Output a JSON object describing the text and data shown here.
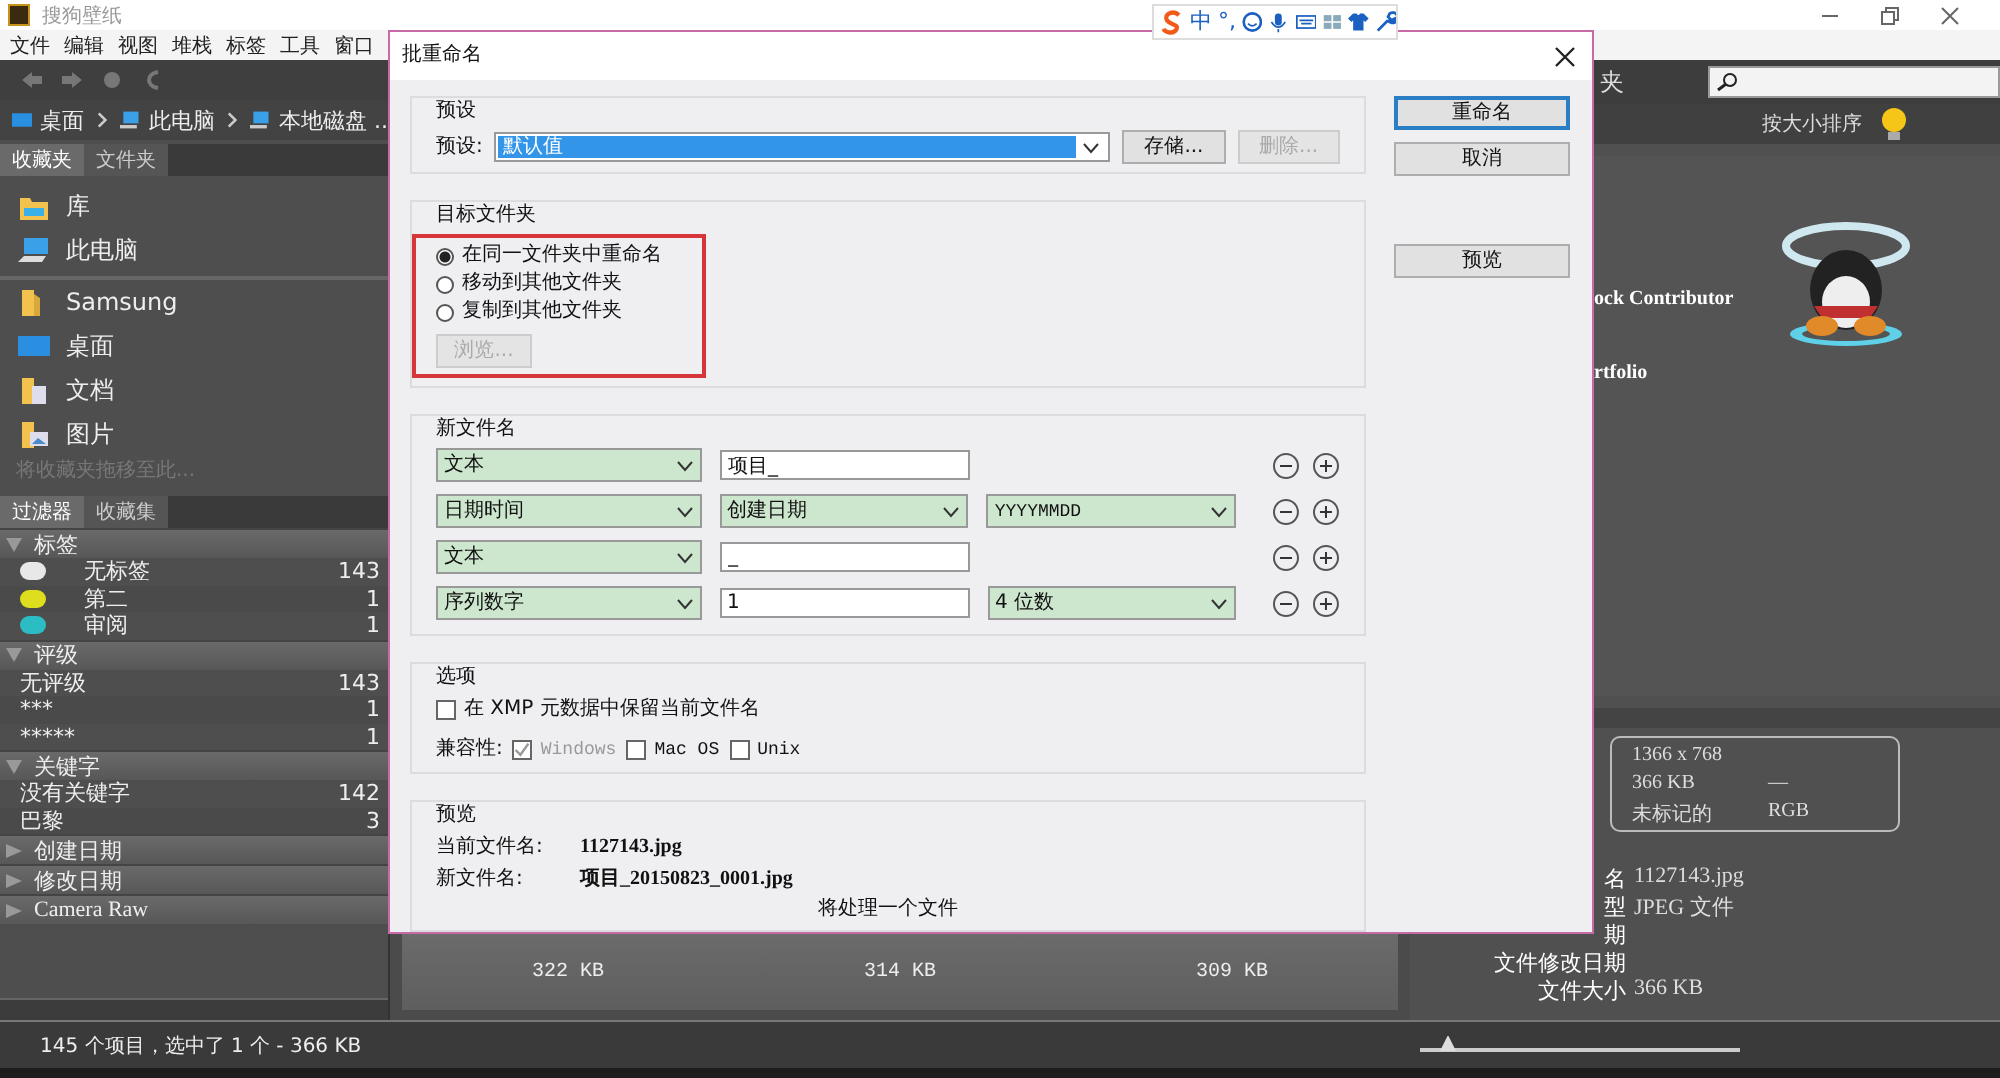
{
  "window": {
    "title": "搜狗壁纸"
  },
  "menu": [
    "文件",
    "编辑",
    "视图",
    "堆栈",
    "标签",
    "工具",
    "窗口"
  ],
  "ime_toolbar": {
    "mode": "中",
    "punct": "°,"
  },
  "left_panel": {
    "path": [
      "桌面",
      "此电脑",
      "本地磁盘 .."
    ],
    "tabs": [
      {
        "label": "收藏夹",
        "selected": true
      },
      {
        "label": "文件夹",
        "selected": false
      }
    ],
    "favorites": [
      {
        "label": "库",
        "kind": "library"
      },
      {
        "label": "此电脑",
        "kind": "computer"
      },
      {
        "label": "Samsung",
        "kind": "folder"
      },
      {
        "label": "桌面",
        "kind": "desktop"
      },
      {
        "label": "文档",
        "kind": "document"
      },
      {
        "label": "图片"
      }
    ],
    "hint": "将收藏夹拖移至此...",
    "filter_tabs": [
      {
        "label": "过滤器",
        "selected": true
      },
      {
        "label": "收藏集",
        "selected": false
      }
    ],
    "filter_groups": [
      {
        "title": "标签",
        "expanded": true,
        "items": [
          {
            "label": "无标签",
            "count": "143",
            "color": "#e8e8e8"
          },
          {
            "label": "第二",
            "count": "1",
            "color": "#dede1e"
          },
          {
            "label": "审阅",
            "count": "1",
            "color": "#2cbcc4"
          }
        ]
      },
      {
        "title": "评级",
        "expanded": true,
        "items": [
          {
            "label": "无评级",
            "count": "143"
          },
          {
            "label": "***",
            "count": "1"
          },
          {
            "label": "*****",
            "count": "1"
          }
        ]
      },
      {
        "title": "关键字",
        "expanded": true,
        "items": [
          {
            "label": "没有关键字",
            "count": "142"
          },
          {
            "label": "巴黎",
            "count": "3"
          }
        ]
      },
      {
        "title": "创建日期",
        "expanded": false
      },
      {
        "title": "修改日期",
        "expanded": false
      },
      {
        "title": "Camera Raw",
        "expanded": false
      }
    ]
  },
  "content": {
    "sizes": [
      "322 KB",
      "314 KB",
      "309 KB"
    ]
  },
  "right_panel": {
    "toolbar_label": "夹",
    "sort": "按大小排序",
    "lines": [
      "ock Contributor",
      "rtfolio"
    ],
    "metadata_box": {
      "dimensions": "1366 x 768",
      "size": "366 KB",
      "dash": "—",
      "label_state": "未标记的",
      "color_mode": "RGB"
    },
    "metadata": [
      {
        "label": "名",
        "value": "1127143.jpg"
      },
      {
        "label": "型",
        "value": "JPEG 文件"
      },
      {
        "label": "期"
      },
      {
        "label": "文件修改日期"
      },
      {
        "label": "文件大小",
        "value": "366 KB"
      }
    ]
  },
  "status_bar": {
    "text": "145 个项目，选中了 1 个 - 366 KB"
  },
  "dialog": {
    "title": "批重命名",
    "buttons": [
      {
        "label": "重命名",
        "default": true
      },
      {
        "label": "取消",
        "default": false
      },
      {
        "label": "预览",
        "default": false
      }
    ],
    "preset": {
      "title": "预设",
      "label": "预设:",
      "value": "默认值",
      "save": {
        "label": "存储...",
        "disabled": false
      },
      "delete": {
        "label": "删除...",
        "disabled": true
      }
    },
    "target": {
      "title": "目标文件夹",
      "highlighted": true,
      "options": [
        {
          "label": "在同一文件夹中重命名",
          "selected": true
        },
        {
          "label": "移动到其他文件夹",
          "selected": false
        },
        {
          "label": "复制到其他文件夹",
          "selected": false
        }
      ],
      "browse": {
        "label": "浏览...",
        "disabled": true
      }
    },
    "new_name": {
      "title": "新文件名",
      "rows": [
        {
          "type": "文本",
          "fields": [
            {
              "kind": "input",
              "value": "项目_"
            }
          ]
        },
        {
          "type": "日期时间",
          "fields": [
            {
              "kind": "select",
              "value": "创建日期"
            },
            {
              "kind": "select",
              "value": "YYYYMMDD"
            }
          ]
        },
        {
          "type": "文本",
          "fields": [
            {
              "kind": "input",
              "value": "_"
            }
          ]
        },
        {
          "type": "序列数字",
          "fields": [
            {
              "kind": "input",
              "value": "1"
            },
            {
              "kind": "select",
              "value": "4 位数"
            }
          ]
        }
      ]
    },
    "options": {
      "title": "选项",
      "keep_xmp": {
        "label": "在 XMP 元数据中保留当前文件名",
        "checked": false
      },
      "compat_label": "兼容性:",
      "compat": [
        {
          "label": "Windows",
          "checked": true,
          "disabled": true
        },
        {
          "label": "Mac OS",
          "checked": false,
          "disabled": false
        },
        {
          "label": "Unix",
          "checked": false,
          "disabled": false
        }
      ]
    },
    "preview": {
      "title": "预览",
      "current_label": "当前文件名:",
      "current": "1127143.jpg",
      "new_label": "新文件名:",
      "new": "项目_20150823_0001.jpg",
      "note": "将处理一个文件"
    }
  }
}
